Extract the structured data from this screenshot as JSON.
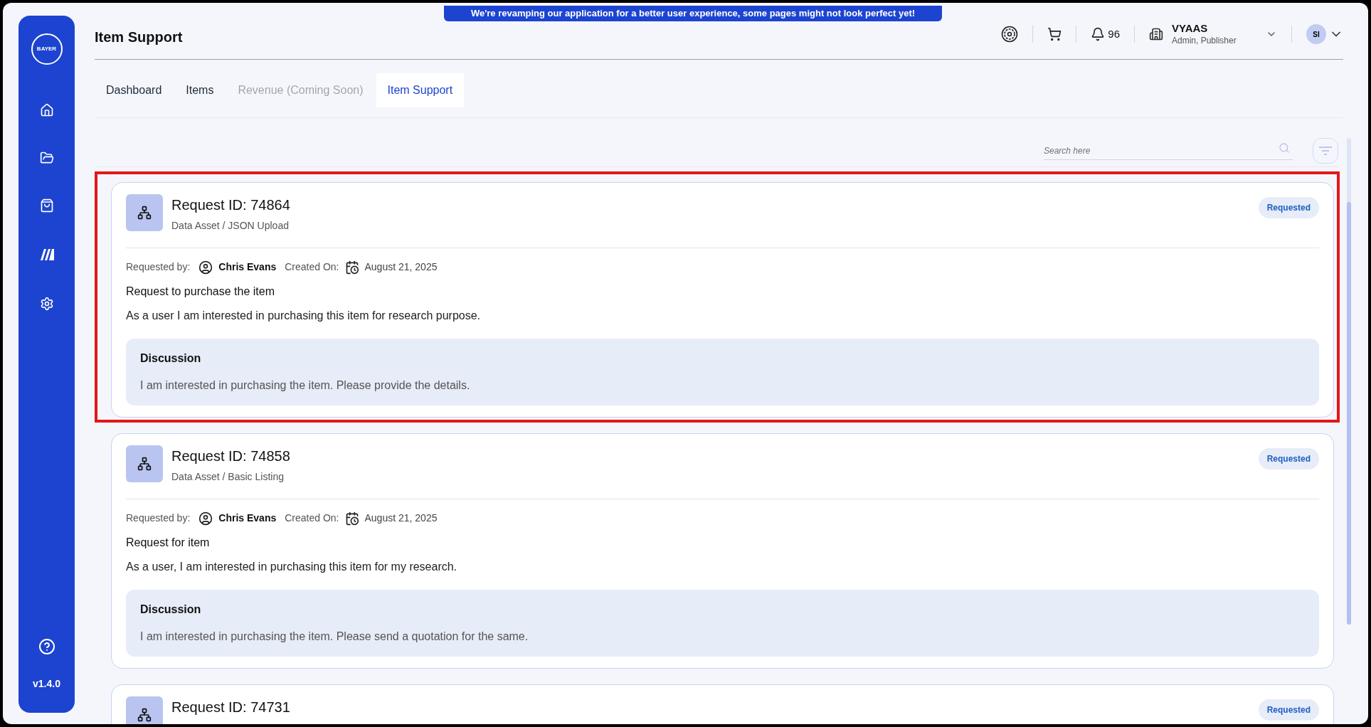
{
  "banner": "We're revamping our application for a better user experience, some pages might not look perfect yet!",
  "sidebar": {
    "logo": "BAYER",
    "version": "v1.4.0",
    "items": [
      {
        "kind": "home",
        "selected": false
      },
      {
        "kind": "folder",
        "selected": false
      },
      {
        "kind": "bag",
        "selected": false
      },
      {
        "kind": "brand",
        "selected": false
      },
      {
        "kind": "settings",
        "selected": false
      }
    ]
  },
  "header": {
    "title": "Item Support",
    "notifications": "96",
    "org": {
      "name": "VYAAS",
      "roles": "Admin, Publisher"
    },
    "avatar": "SI"
  },
  "tabs": [
    {
      "label": "Dashboard",
      "selected": false,
      "disabled": false
    },
    {
      "label": "Items",
      "selected": false,
      "disabled": false
    },
    {
      "label": "Revenue (Coming Soon)",
      "selected": false,
      "disabled": true
    },
    {
      "label": "Item Support",
      "selected": true,
      "disabled": false
    }
  ],
  "search": {
    "placeholder": "Search here"
  },
  "requests": [
    {
      "title": "Request ID: 74864",
      "category": "Data Asset / JSON Upload",
      "status": "Requested",
      "highlighted": true,
      "requested_by_label": "Requested by:",
      "requester": "Chris Evans",
      "created_label": "Created On:",
      "created_on": "August 21, 2025",
      "subject": "Request to purchase the item",
      "description": "As a user I am interested in purchasing this item for research purpose.",
      "discussion": {
        "heading": "Discussion",
        "text": "I am interested in purchasing the item. Please provide the details."
      }
    },
    {
      "title": "Request ID: 74858",
      "category": "Data Asset / Basic Listing",
      "status": "Requested",
      "highlighted": false,
      "requested_by_label": "Requested by:",
      "requester": "Chris Evans",
      "created_label": "Created On:",
      "created_on": "August 21, 2025",
      "subject": "Request for item",
      "description": "As a user, I am interested in purchasing this item for my research.",
      "discussion": {
        "heading": "Discussion",
        "text": "I am interested in purchasing the item. Please send a quotation for the same."
      }
    },
    {
      "title": "Request ID: 74731",
      "status": "Requested",
      "highlighted": false
    }
  ]
}
